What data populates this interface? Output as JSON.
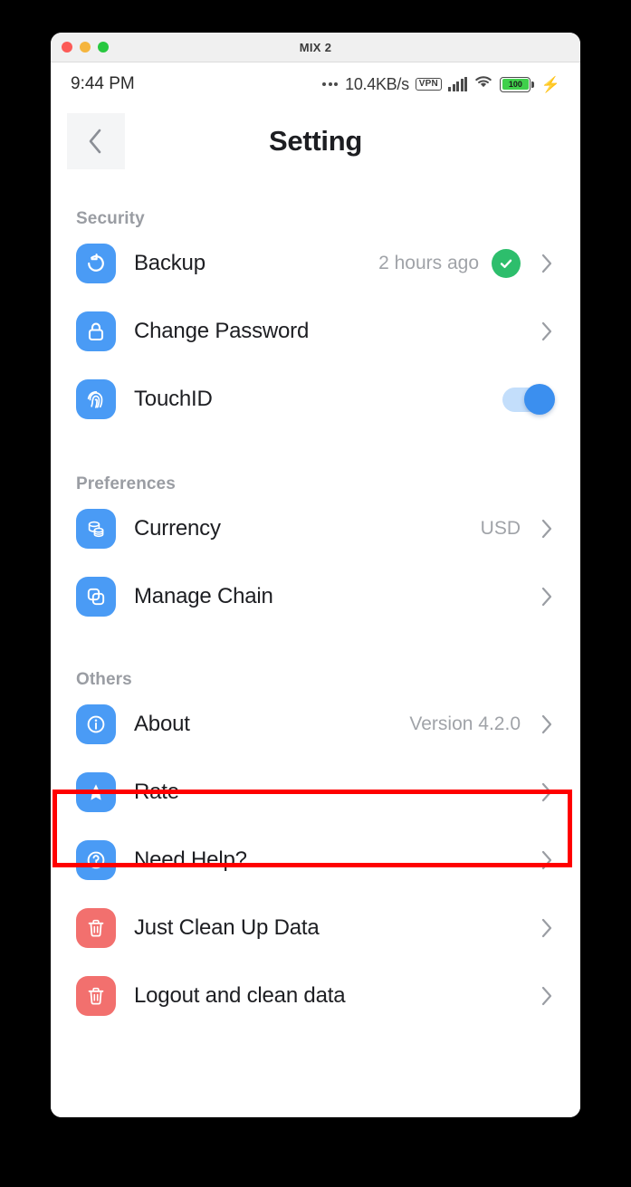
{
  "window": {
    "title": "MIX 2",
    "traffic_lights": [
      "close",
      "minimize",
      "maximize"
    ]
  },
  "status_bar": {
    "time": "9:44 PM",
    "network_speed": "10.4KB/s",
    "vpn_label": "VPN",
    "battery_percent": "100",
    "icons": [
      "dots-icon",
      "vpn-badge-icon",
      "cellular-signal-icon",
      "wifi-icon",
      "battery-icon",
      "charging-bolt-icon"
    ]
  },
  "nav": {
    "back_icon": "chevron-left-icon",
    "title": "Setting"
  },
  "sections": [
    {
      "title": "Security",
      "rows": [
        {
          "label": "Backup",
          "icon": "refresh-icon",
          "icon_color": "#4A9BF5",
          "value": "2 hours ago",
          "badge": "check-circle-icon",
          "badge_color": "#2DBE6C",
          "accessory": "chevron-right-icon"
        },
        {
          "label": "Change Password",
          "icon": "lock-icon",
          "icon_color": "#4A9BF5",
          "value": "",
          "accessory": "chevron-right-icon"
        },
        {
          "label": "TouchID",
          "icon": "fingerprint-icon",
          "icon_color": "#4A9BF5",
          "value": "",
          "accessory": "toggle-switch",
          "toggle_on": true
        }
      ]
    },
    {
      "title": "Preferences",
      "rows": [
        {
          "label": "Currency",
          "icon": "coins-stack-icon",
          "icon_color": "#4A9BF5",
          "value": "USD",
          "accessory": "chevron-right-icon"
        },
        {
          "label": "Manage Chain",
          "icon": "layers-copy-icon",
          "icon_color": "#4A9BF5",
          "value": "",
          "accessory": "chevron-right-icon"
        }
      ]
    },
    {
      "title": "Others",
      "rows": [
        {
          "label": "About",
          "icon": "info-circle-icon",
          "icon_color": "#4A9BF5",
          "value": "Version 4.2.0",
          "accessory": "chevron-right-icon"
        },
        {
          "label": "Rate",
          "icon": "star-icon",
          "icon_color": "#4A9BF5",
          "value": "",
          "accessory": "chevron-right-icon",
          "highlighted": true
        },
        {
          "label": "Need Help?",
          "icon": "question-circle-icon",
          "icon_color": "#4A9BF5",
          "value": "",
          "accessory": "chevron-right-icon"
        },
        {
          "label": "Just Clean Up Data",
          "icon": "trash-icon",
          "icon_color": "#F2706E",
          "value": "",
          "accessory": "chevron-right-icon"
        },
        {
          "label": "Logout and clean data",
          "icon": "trash-icon",
          "icon_color": "#F2706E",
          "value": "",
          "accessory": "chevron-right-icon"
        }
      ]
    }
  ],
  "highlight": {
    "target": "Rate",
    "color": "#FF0000"
  }
}
